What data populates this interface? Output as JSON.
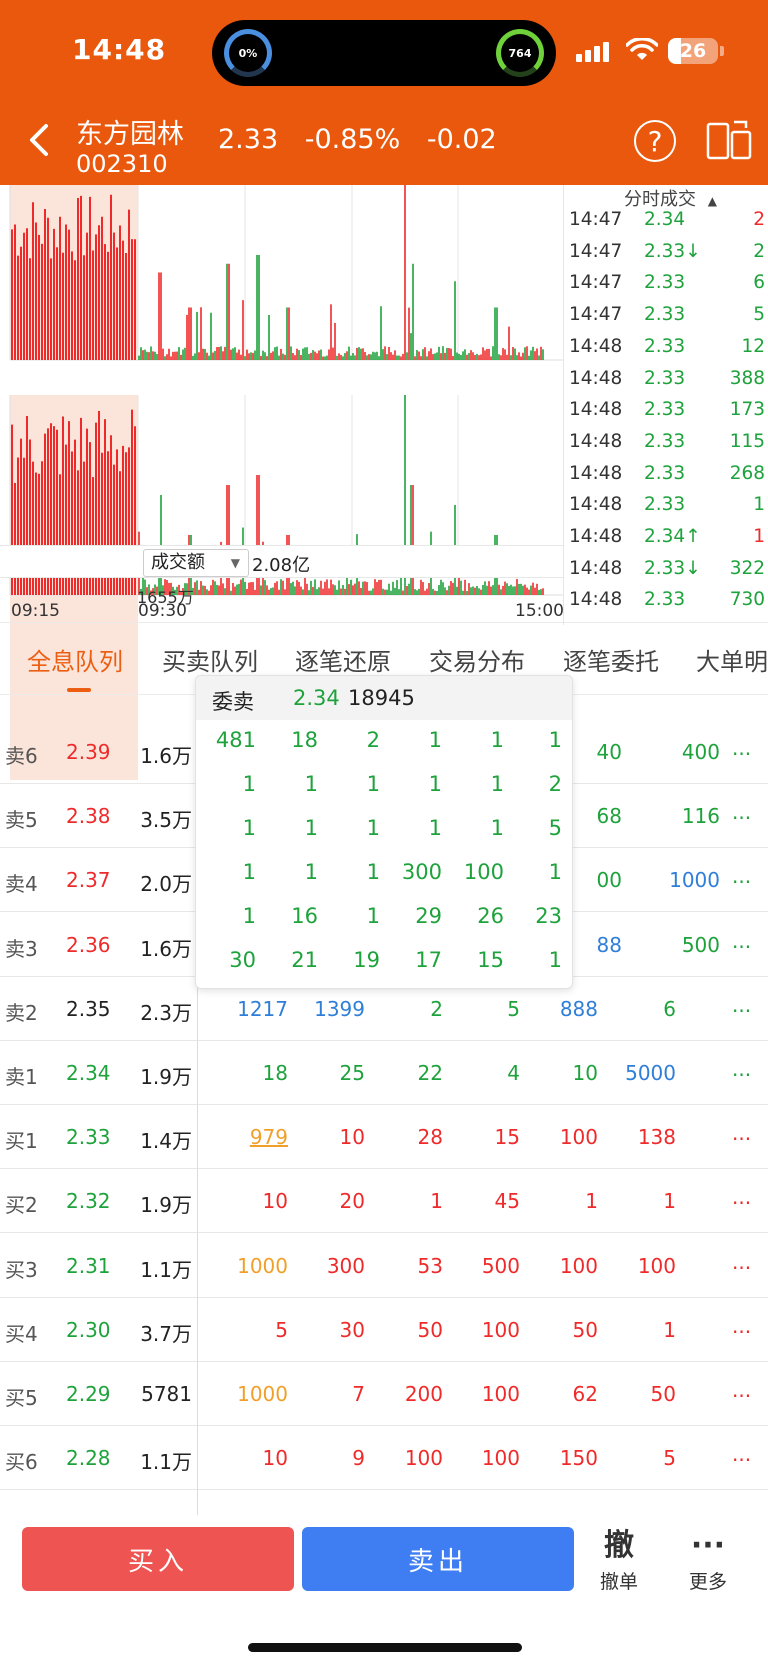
{
  "status_bar": {
    "time": "14:48",
    "left_ring": "0%",
    "right_ring": "764",
    "battery": "26"
  },
  "header": {
    "name": "东方园林",
    "code": "002310",
    "price": "2.33",
    "pct": "-0.85%",
    "change": "-0.02",
    "help_icon": "?"
  },
  "chart": {
    "metric_label": "成交额",
    "metric_value": "2.08亿",
    "max_label": "1655万",
    "time_labels": [
      "09:15",
      "09:30",
      "15:00"
    ]
  },
  "ticks": {
    "title": "分时成交",
    "rows": [
      {
        "t": "14:47",
        "p": "2.34",
        "v": "2",
        "pc": "green",
        "vc": "red"
      },
      {
        "t": "14:47",
        "p": "2.33↓",
        "v": "2",
        "pc": "green",
        "vc": "green"
      },
      {
        "t": "14:47",
        "p": "2.33",
        "v": "6",
        "pc": "green",
        "vc": "green"
      },
      {
        "t": "14:47",
        "p": "2.33",
        "v": "5",
        "pc": "green",
        "vc": "green"
      },
      {
        "t": "14:48",
        "p": "2.33",
        "v": "12",
        "pc": "green",
        "vc": "green"
      },
      {
        "t": "14:48",
        "p": "2.33",
        "v": "388",
        "pc": "green",
        "vc": "green"
      },
      {
        "t": "14:48",
        "p": "2.33",
        "v": "173",
        "pc": "green",
        "vc": "green"
      },
      {
        "t": "14:48",
        "p": "2.33",
        "v": "115",
        "pc": "green",
        "vc": "green"
      },
      {
        "t": "14:48",
        "p": "2.33",
        "v": "268",
        "pc": "green",
        "vc": "green"
      },
      {
        "t": "14:48",
        "p": "2.33",
        "v": "1",
        "pc": "green",
        "vc": "green"
      },
      {
        "t": "14:48",
        "p": "2.34↑",
        "v": "1",
        "pc": "green",
        "vc": "red"
      },
      {
        "t": "14:48",
        "p": "2.33↓",
        "v": "322",
        "pc": "green",
        "vc": "green"
      },
      {
        "t": "14:48",
        "p": "2.33",
        "v": "730",
        "pc": "green",
        "vc": "green"
      }
    ]
  },
  "tabs": [
    "全息队列",
    "买卖队列",
    "逐笔还原",
    "交易分布",
    "逐笔委托",
    "大单明"
  ],
  "book": [
    {
      "lab": "卖6",
      "p": "2.39",
      "pc": "red",
      "vol": "1.6万",
      "q": [
        {
          "v": "40",
          "c": "green"
        },
        {
          "v": "400",
          "c": "green"
        }
      ],
      "qx": [
        552,
        650
      ]
    },
    {
      "lab": "卖5",
      "p": "2.38",
      "pc": "red",
      "vol": "3.5万",
      "q": [
        {
          "v": "68",
          "c": "green"
        },
        {
          "v": "116",
          "c": "green"
        }
      ],
      "qx": [
        552,
        650
      ]
    },
    {
      "lab": "卖4",
      "p": "2.37",
      "pc": "red",
      "vol": "2.0万",
      "q": [
        {
          "v": "00",
          "c": "green"
        },
        {
          "v": "1000",
          "c": "blue"
        }
      ],
      "qx": [
        552,
        650
      ]
    },
    {
      "lab": "卖3",
      "p": "2.36",
      "pc": "red",
      "vol": "1.6万",
      "q": [
        {
          "v": "88",
          "c": "blue"
        },
        {
          "v": "500",
          "c": "green"
        }
      ],
      "qx": [
        552,
        650
      ]
    },
    {
      "lab": "卖2",
      "p": "2.35",
      "pc": "black",
      "vol": "2.3万",
      "q": [
        {
          "v": "1217",
          "c": "blue"
        },
        {
          "v": "1399",
          "c": "blue"
        },
        {
          "v": "2",
          "c": "green"
        },
        {
          "v": "5",
          "c": "green"
        },
        {
          "v": "888",
          "c": "blue"
        },
        {
          "v": "6",
          "c": "green"
        }
      ],
      "qx": [
        218,
        295,
        373,
        450,
        528,
        606
      ]
    },
    {
      "lab": "卖1",
      "p": "2.34",
      "pc": "green",
      "vol": "1.9万",
      "q": [
        {
          "v": "18",
          "c": "green"
        },
        {
          "v": "25",
          "c": "green"
        },
        {
          "v": "22",
          "c": "green"
        },
        {
          "v": "4",
          "c": "green"
        },
        {
          "v": "10",
          "c": "green"
        },
        {
          "v": "5000",
          "c": "blue"
        }
      ],
      "qx": [
        218,
        295,
        373,
        450,
        528,
        606
      ]
    },
    {
      "lab": "买1",
      "p": "2.33",
      "pc": "green",
      "vol": "1.4万",
      "q": [
        {
          "v": "979",
          "c": "orange"
        },
        {
          "v": "10",
          "c": "red"
        },
        {
          "v": "28",
          "c": "red"
        },
        {
          "v": "15",
          "c": "red"
        },
        {
          "v": "100",
          "c": "red"
        },
        {
          "v": "138",
          "c": "red"
        }
      ],
      "qx": [
        218,
        295,
        373,
        450,
        528,
        606
      ]
    },
    {
      "lab": "买2",
      "p": "2.32",
      "pc": "green",
      "vol": "1.9万",
      "q": [
        {
          "v": "10",
          "c": "red"
        },
        {
          "v": "20",
          "c": "red"
        },
        {
          "v": "1",
          "c": "red"
        },
        {
          "v": "45",
          "c": "red"
        },
        {
          "v": "1",
          "c": "red"
        },
        {
          "v": "1",
          "c": "red"
        }
      ],
      "qx": [
        218,
        295,
        373,
        450,
        528,
        606
      ]
    },
    {
      "lab": "买3",
      "p": "2.31",
      "pc": "green",
      "vol": "1.1万",
      "q": [
        {
          "v": "1000",
          "c": "orange"
        },
        {
          "v": "300",
          "c": "red"
        },
        {
          "v": "53",
          "c": "red"
        },
        {
          "v": "500",
          "c": "red"
        },
        {
          "v": "100",
          "c": "red"
        },
        {
          "v": "100",
          "c": "red"
        }
      ],
      "qx": [
        218,
        295,
        373,
        450,
        528,
        606
      ]
    },
    {
      "lab": "买4",
      "p": "2.30",
      "pc": "green",
      "vol": "3.7万",
      "q": [
        {
          "v": "5",
          "c": "red"
        },
        {
          "v": "30",
          "c": "red"
        },
        {
          "v": "50",
          "c": "red"
        },
        {
          "v": "100",
          "c": "red"
        },
        {
          "v": "50",
          "c": "red"
        },
        {
          "v": "1",
          "c": "red"
        }
      ],
      "qx": [
        218,
        295,
        373,
        450,
        528,
        606
      ]
    },
    {
      "lab": "买5",
      "p": "2.29",
      "pc": "green",
      "vol": "5781",
      "q": [
        {
          "v": "1000",
          "c": "orange"
        },
        {
          "v": "7",
          "c": "red"
        },
        {
          "v": "200",
          "c": "red"
        },
        {
          "v": "100",
          "c": "red"
        },
        {
          "v": "62",
          "c": "red"
        },
        {
          "v": "50",
          "c": "red"
        }
      ],
      "qx": [
        218,
        295,
        373,
        450,
        528,
        606
      ]
    },
    {
      "lab": "买6",
      "p": "2.28",
      "pc": "green",
      "vol": "1.1万",
      "q": [
        {
          "v": "10",
          "c": "red"
        },
        {
          "v": "9",
          "c": "red"
        },
        {
          "v": "100",
          "c": "red"
        },
        {
          "v": "100",
          "c": "red"
        },
        {
          "v": "150",
          "c": "red"
        },
        {
          "v": "5",
          "c": "red"
        }
      ],
      "qx": [
        218,
        295,
        373,
        450,
        528,
        606
      ]
    }
  ],
  "more_label": "...",
  "popup": {
    "label": "委卖",
    "price": "2.34",
    "volume": "18945",
    "rows": [
      [
        "481",
        "18",
        "2",
        "1",
        "1",
        "1"
      ],
      [
        "1",
        "1",
        "1",
        "1",
        "1",
        "2"
      ],
      [
        "1",
        "1",
        "1",
        "1",
        "1",
        "5"
      ],
      [
        "1",
        "1",
        "1",
        "300",
        "100",
        "1"
      ],
      [
        "1",
        "16",
        "1",
        "29",
        "26",
        "23"
      ],
      [
        "30",
        "21",
        "19",
        "17",
        "15",
        "1"
      ]
    ]
  },
  "bottom": {
    "buy": "买入",
    "sell": "卖出",
    "cancel_icon": "撤",
    "cancel": "撤单",
    "more_icon": "···",
    "more": "更多"
  },
  "colors": {
    "brand": "#e9580c",
    "red": "#ee2a2a",
    "green": "#1ea23c",
    "blue": "#2f7ed8"
  }
}
